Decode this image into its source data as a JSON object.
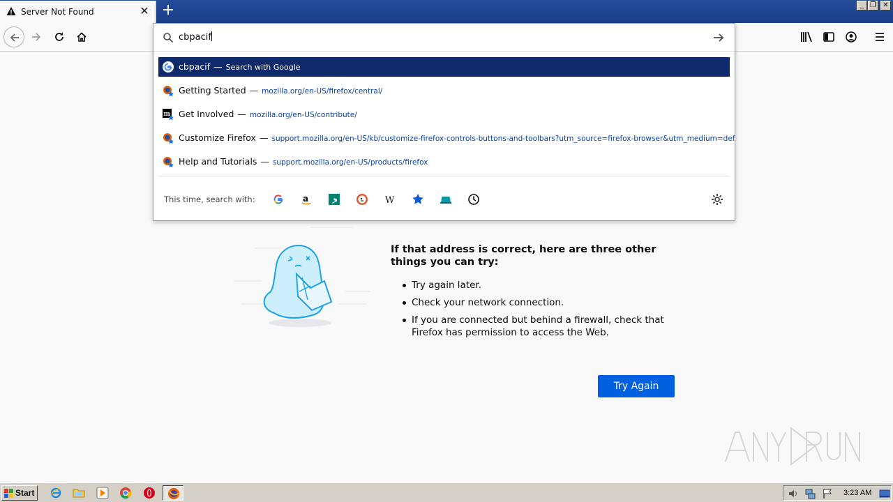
{
  "tab": {
    "title": "Server Not Found",
    "new_tab_label": "+"
  },
  "window_buttons": {
    "minimize": "_",
    "restore": "❐",
    "close": "✕"
  },
  "urlbar": {
    "value": "cbpacif"
  },
  "suggestions": [
    {
      "title": "cbpacif",
      "action": "Search with Google",
      "icon": "google-icon",
      "selected": true
    },
    {
      "title": "Getting Started",
      "url": "mozilla.org/en-US/firefox/central/",
      "icon": "firefox-bookmark-icon"
    },
    {
      "title": "Get Involved",
      "url": "mozilla.org/en-US/contribute/",
      "icon": "mozilla-bookmark-icon"
    },
    {
      "title": "Customize Firefox",
      "url": "support.mozilla.org/en-US/kb/customize-firefox-controls-buttons-and-toolbars?utm_source=firefox-browser&utm_medium=default-bookmarks",
      "icon": "firefox-bookmark-icon"
    },
    {
      "title": "Help and Tutorials",
      "url": "support.mozilla.org/en-US/products/firefox",
      "icon": "firefox-bookmark-icon"
    }
  ],
  "separator": "—",
  "oneoff": {
    "label": "This time, search with:",
    "engines": [
      "google-icon",
      "amazon-icon",
      "bing-icon",
      "duckduckgo-icon",
      "wikipedia-icon",
      "bookmarks-icon",
      "tabs-icon",
      "history-icon"
    ]
  },
  "error_page": {
    "heading": "If that address is correct, here are three other things you can try:",
    "items": [
      "Try again later.",
      "Check your network connection.",
      "If you are connected but behind a firewall, check that Firefox has permission to access the Web."
    ],
    "try_again_label": "Try Again"
  },
  "taskbar": {
    "start_label": "Start",
    "clock": "3:23 AM"
  },
  "colors": {
    "accent": "#0060df",
    "selected_row": "#0e2a6a",
    "titlebar": "#1f4590"
  }
}
